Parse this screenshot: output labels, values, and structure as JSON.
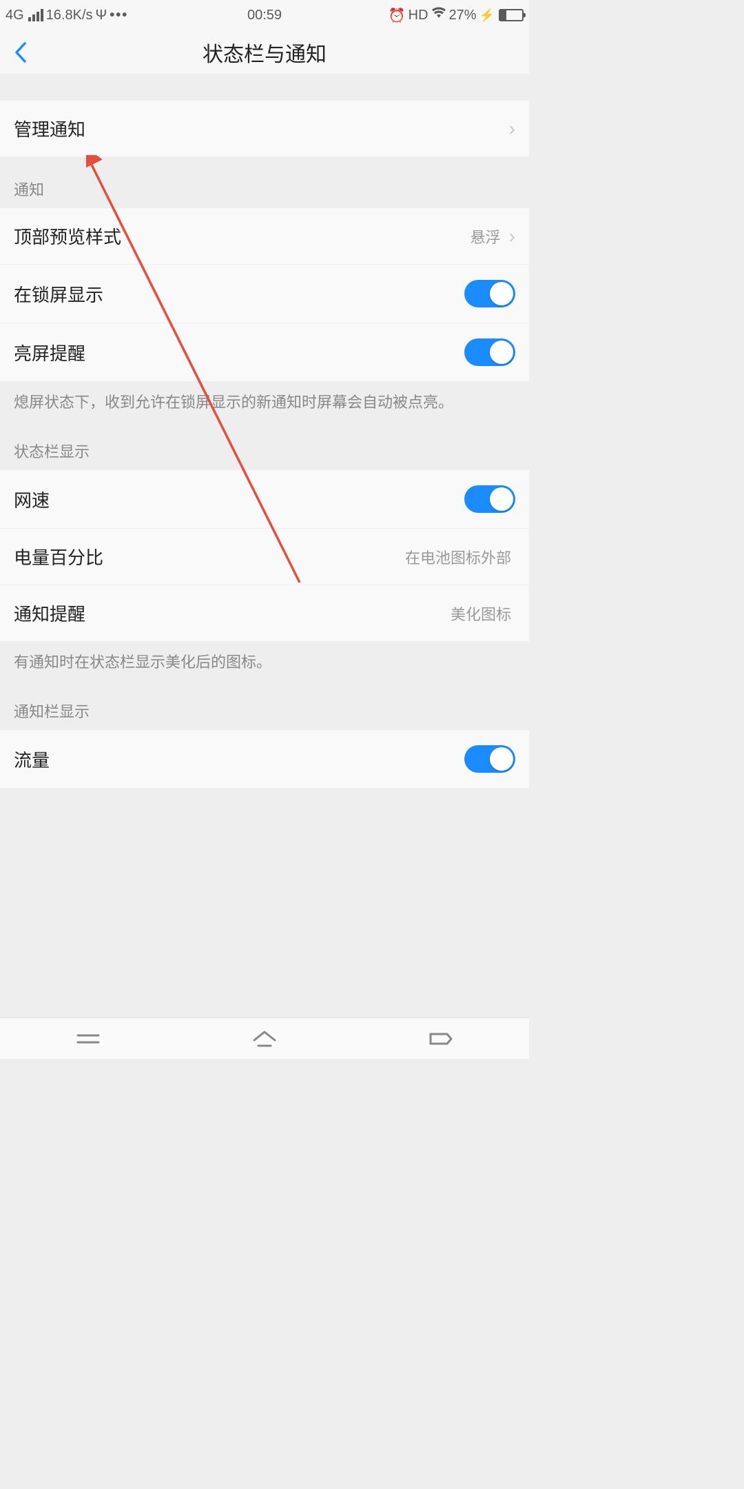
{
  "statusbar": {
    "network_type": "4G",
    "speed": "16.8K/s",
    "time": "00:59",
    "hd": "HD",
    "battery_percent": "27%"
  },
  "header": {
    "title": "状态栏与通知"
  },
  "items": {
    "manage_notifications": "管理通知",
    "section_notify": "通知",
    "top_preview": {
      "label": "顶部预览样式",
      "value": "悬浮"
    },
    "lockscreen": "在锁屏显示",
    "wake_screen": "亮屏提醒",
    "wake_screen_note": "熄屏状态下，收到允许在锁屏显示的新通知时屏幕会自动被点亮。",
    "section_statusbar": "状态栏显示",
    "netspeed": "网速",
    "battery_pct": {
      "label": "电量百分比",
      "value": "在电池图标外部"
    },
    "notify_remind": {
      "label": "通知提醒",
      "value": "美化图标"
    },
    "notify_remind_note": "有通知时在状态栏显示美化后的图标。",
    "section_notifbar": "通知栏显示",
    "traffic": "流量"
  }
}
